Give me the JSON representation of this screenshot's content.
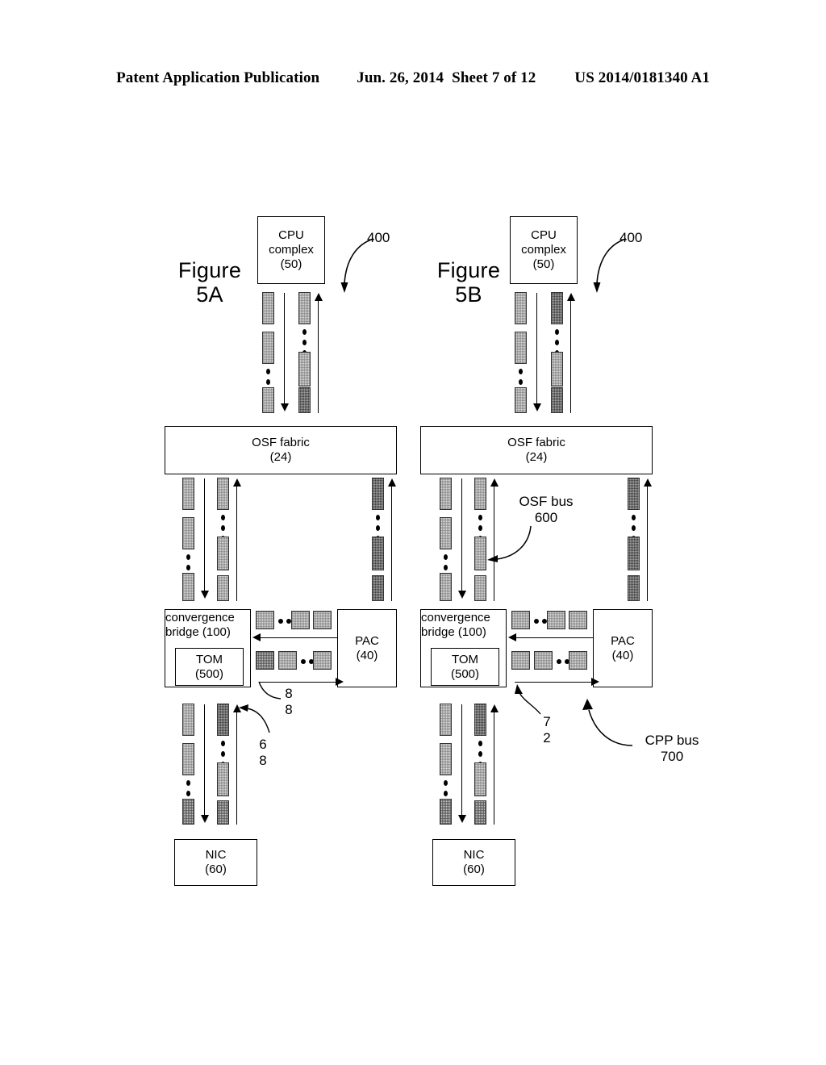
{
  "header": {
    "publication": "Patent Application Publication",
    "date": "Jun. 26, 2014",
    "sheet": "Sheet 7 of 12",
    "patent_number": "US 2014/0181340 A1"
  },
  "figures": [
    {
      "id": "fig5a",
      "label": "Figure\n5A",
      "nodes": {
        "cpu": {
          "line1": "CPU",
          "line2": "complex",
          "line3": "(50)"
        },
        "osf_fabric": {
          "line1": "OSF fabric",
          "line2": "(24)"
        },
        "convergence_bridge": {
          "line1": "convergence",
          "line2": "bridge (100)"
        },
        "tom": {
          "line1": "TOM",
          "line2": "(500)"
        },
        "pac": {
          "line1": "PAC",
          "line2": "(40)"
        },
        "nic": {
          "line1": "NIC",
          "line2": "(60)"
        }
      },
      "callouts": [
        {
          "name": "ref-400",
          "text": "400"
        }
      ],
      "number_labels": [
        {
          "name": "ref-88",
          "text": "8\n8"
        },
        {
          "name": "ref-68",
          "text": "6\n8"
        }
      ],
      "queues": {
        "cpu_down": {
          "fills": [
            "light",
            "light",
            "light"
          ],
          "dots_after": 2
        },
        "cpu_up": {
          "fills": [
            "light",
            "light",
            "dark"
          ],
          "dots_after": 1
        },
        "osf_down": {
          "fills": [
            "light",
            "light",
            "light"
          ],
          "dots_after": 2
        },
        "osf_up": {
          "fills": [
            "light",
            "light",
            "light"
          ],
          "dots_after": 1
        },
        "pac_up": {
          "fills": [
            "dark",
            "dark",
            "dark"
          ],
          "dots_after": 1
        },
        "nic_down": {
          "fills": [
            "light",
            "light",
            "med"
          ],
          "dots_after": 2
        },
        "nic_up": {
          "fills": [
            "dark",
            "light",
            "med"
          ],
          "dots_after": 1
        },
        "bridge_in": {
          "fills": [
            "light",
            "light",
            "light"
          ],
          "dots_after": 1
        },
        "bridge_out": {
          "fills": [
            "med",
            "light",
            "light"
          ],
          "dots_after": 2
        }
      }
    },
    {
      "id": "fig5b",
      "label": "Figure\n5B",
      "nodes": {
        "cpu": {
          "line1": "CPU",
          "line2": "complex",
          "line3": "(50)"
        },
        "osf_fabric": {
          "line1": "OSF fabric",
          "line2": "(24)"
        },
        "convergence_bridge": {
          "line1": "convergence",
          "line2": "bridge (100)"
        },
        "tom": {
          "line1": "TOM",
          "line2": "(500)"
        },
        "pac": {
          "line1": "PAC",
          "line2": "(40)"
        },
        "nic": {
          "line1": "NIC",
          "line2": "(60)"
        }
      },
      "callouts": [
        {
          "name": "ref-400",
          "text": "400"
        },
        {
          "name": "osf-bus",
          "text": "OSF bus\n600"
        },
        {
          "name": "cpp-bus",
          "text": "CPP bus\n700"
        }
      ],
      "number_labels": [
        {
          "name": "ref-72",
          "text": "7\n2"
        }
      ],
      "queues": {
        "cpu_down": {
          "fills": [
            "light",
            "light",
            "light"
          ],
          "dots_after": 2
        },
        "cpu_up": {
          "fills": [
            "dark",
            "light",
            "dark"
          ],
          "dots_after": 1
        },
        "osf_down": {
          "fills": [
            "light",
            "light",
            "light"
          ],
          "dots_after": 2
        },
        "osf_up": {
          "fills": [
            "light",
            "light",
            "light"
          ],
          "dots_after": 1
        },
        "pac_up": {
          "fills": [
            "dark",
            "dark",
            "dark"
          ],
          "dots_after": 1
        },
        "nic_down": {
          "fills": [
            "light",
            "light",
            "med"
          ],
          "dots_after": 2
        },
        "nic_up": {
          "fills": [
            "dark",
            "light",
            "med"
          ],
          "dots_after": 1
        },
        "bridge_in": {
          "fills": [
            "light",
            "light",
            "light"
          ],
          "dots_after": 1
        },
        "bridge_out": {
          "fills": [
            "light",
            "light",
            "light"
          ],
          "dots_after": 2
        }
      }
    }
  ],
  "colors": {
    "ink": "#000000",
    "light_fill": "#dcdcdc",
    "medium_fill": "#c9c9c9",
    "dark_fill": "#3a3a3a"
  }
}
